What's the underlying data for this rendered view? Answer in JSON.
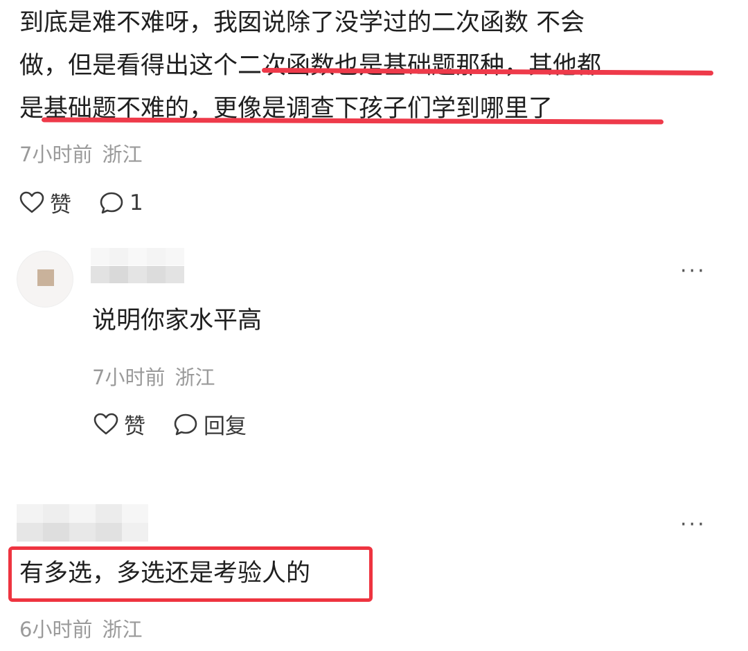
{
  "comment": {
    "lines": [
      "到底是难不难呀，我囡说除了没学过的二次函数 不会",
      "做，但是看得出这个二次函数也是基础题那种，其他都",
      "是基础题不难的，更像是调查下孩子们学到哪里了"
    ],
    "time": "7小时前",
    "location": "浙江",
    "like_label": "赞",
    "reply_count": "1",
    "underline_color": "#ee3a4a"
  },
  "reply": {
    "text": "说明你家水平高",
    "time": "7小时前",
    "location": "浙江",
    "like_label": "赞",
    "reply_label": "回复",
    "more_label": "···"
  },
  "comment2": {
    "text": "有多选，多选还是考验人的",
    "time": "6小时前",
    "location": "浙江",
    "more_label": "···",
    "highlight_color": "#ee3440"
  }
}
